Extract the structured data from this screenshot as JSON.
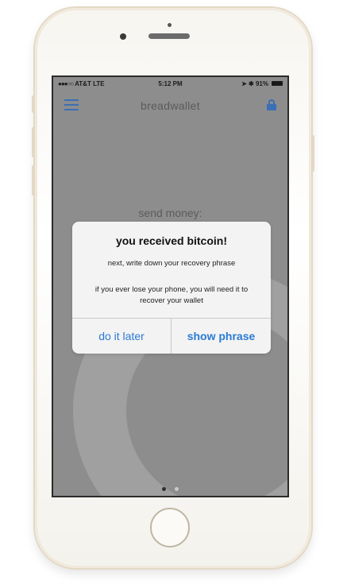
{
  "status_bar": {
    "signal": "●●●○○",
    "carrier": "AT&T",
    "network": "LTE",
    "time": "5:12 PM",
    "indicators": "➤ ✱",
    "battery": "91%"
  },
  "nav": {
    "title": "breadwallet",
    "menu_icon": "hamburger-menu-icon",
    "lock_icon": "lock-icon",
    "accent_color": "#3b6fb6"
  },
  "main": {
    "send_label": "send money:",
    "page_count": 2,
    "active_page": 1
  },
  "alert": {
    "title": "you received bitcoin!",
    "line1": "next, write down your recovery phrase",
    "line2": "if you ever lose your phone, you will need it to recover your wallet",
    "left_button": "do it later",
    "right_button": "show phrase",
    "button_color": "#2a7ad5"
  }
}
